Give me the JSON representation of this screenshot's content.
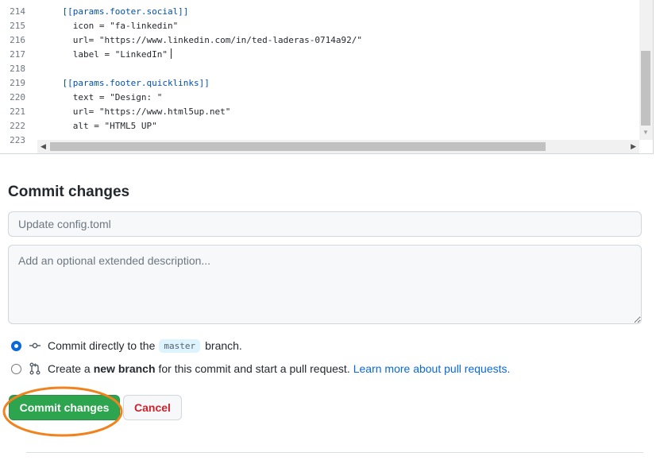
{
  "editor": {
    "lines": [
      {
        "num": "214",
        "code": "    [[params.footer.social]]",
        "kind": "section"
      },
      {
        "num": "215",
        "code": "      icon = \"fa-linkedin\"",
        "kind": "plain"
      },
      {
        "num": "216",
        "code": "      url= \"https://www.linkedin.com/in/ted-laderas-0714a92/\"",
        "kind": "plain"
      },
      {
        "num": "217",
        "code": "      label = \"LinkedIn\"",
        "kind": "plain"
      },
      {
        "num": "218",
        "code": "",
        "kind": "plain"
      },
      {
        "num": "219",
        "code": "    [[params.footer.quicklinks]]",
        "kind": "section"
      },
      {
        "num": "220",
        "code": "      text = \"Design: \"",
        "kind": "plain"
      },
      {
        "num": "221",
        "code": "      url= \"https://www.html5up.net\"",
        "kind": "plain"
      },
      {
        "num": "222",
        "code": "      alt = \"HTML5 UP\"",
        "kind": "plain"
      },
      {
        "num": "223",
        "code": "",
        "kind": "plain"
      }
    ],
    "caret_line": "217"
  },
  "commit": {
    "title": "Commit changes",
    "summary_placeholder": "Update config.toml",
    "summary_value": "",
    "description_placeholder": "Add an optional extended description...",
    "description_value": "",
    "option_direct": {
      "checked": true,
      "text_before": "Commit directly to the",
      "branch": "master",
      "text_after": "branch.",
      "icon": "git-commit-icon"
    },
    "option_new_branch": {
      "checked": false,
      "text_before": "Create a",
      "bold_text": "new branch",
      "text_after": "for this commit and start a pull request.",
      "link_text": "Learn more about pull requests.",
      "icon": "git-pull-request-icon"
    },
    "commit_button_label": "Commit changes",
    "cancel_button_label": "Cancel"
  },
  "colors": {
    "commit_green": "#2da44e",
    "cancel_red": "#cf222e",
    "link_blue": "#0969da",
    "annotation_orange": "#f0831e"
  }
}
